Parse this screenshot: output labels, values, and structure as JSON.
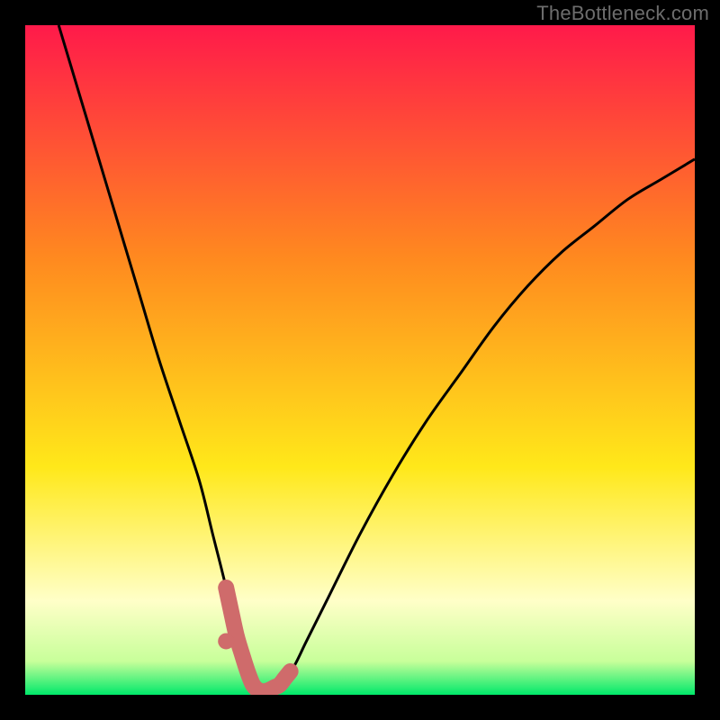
{
  "watermark": "TheBottleneck.com",
  "colors": {
    "bg_frame": "#000000",
    "gradient_top": "#ff1a4a",
    "gradient_mid1": "#ff8a1f",
    "gradient_mid2": "#ffe81a",
    "gradient_pale": "#ffffc8",
    "gradient_bottom": "#00e86a",
    "curve": "#000000",
    "marker": "#cf6b6b"
  },
  "chart_data": {
    "type": "line",
    "title": "",
    "xlabel": "",
    "ylabel": "",
    "xlim": [
      0,
      100
    ],
    "ylim": [
      0,
      100
    ],
    "grid": false,
    "legend": false,
    "annotations": [
      "TheBottleneck.com"
    ],
    "series": [
      {
        "name": "bottleneck-curve",
        "x": [
          5,
          8,
          11,
          14,
          17,
          20,
          23,
          26,
          28,
          30,
          31.5,
          33,
          34,
          35,
          36,
          38,
          40,
          42,
          45,
          50,
          55,
          60,
          65,
          70,
          75,
          80,
          85,
          90,
          95,
          100
        ],
        "y": [
          100,
          90,
          80,
          70,
          60,
          50,
          41,
          32,
          24,
          16,
          9,
          4,
          1.5,
          0.5,
          0.5,
          1.5,
          4,
          8,
          14,
          24,
          33,
          41,
          48,
          55,
          61,
          66,
          70,
          74,
          77,
          80
        ]
      }
    ],
    "markers": {
      "name": "highlight-band",
      "x_start": 30,
      "x_end": 40,
      "y_approx": 4,
      "dot": {
        "x": 30,
        "y": 8
      }
    },
    "gradient_stops": [
      {
        "pos": 0.0,
        "color": "#ff1a4a"
      },
      {
        "pos": 0.35,
        "color": "#ff8a1f"
      },
      {
        "pos": 0.66,
        "color": "#ffe81a"
      },
      {
        "pos": 0.86,
        "color": "#ffffc8"
      },
      {
        "pos": 0.95,
        "color": "#c8ff9a"
      },
      {
        "pos": 1.0,
        "color": "#00e86a"
      }
    ]
  }
}
